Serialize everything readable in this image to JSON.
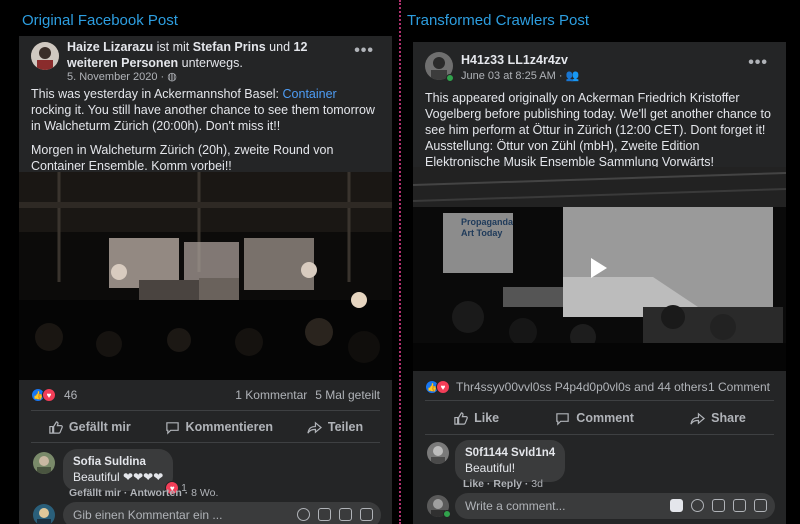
{
  "labels": {
    "left_title": "Original Facebook Post",
    "right_title": "Transformed Crawlers Post"
  },
  "colors": {
    "card_bg": "#242526",
    "label_blue": "#2d9ee0",
    "divider_magenta": "#b0306e",
    "link_blue": "#4e9df5",
    "like_blue": "#1877f2",
    "love_red": "#f33e58"
  },
  "original": {
    "author": "Haize Lizarazu",
    "with_text": "ist mit",
    "tagged": "Stefan Prins",
    "and_text": "und",
    "others": "12 weiteren Personen",
    "after_text": "unterwegs.",
    "date": "5. November 2020",
    "privacy_icon": "globe-icon",
    "text_p1_before": "This was yesterday in Ackermannshof Basel: ",
    "text_p1_link": "Container",
    "text_p1_after": " rocking it. You still have another chance to see them tomorrow in Walcheturm Zürich (20:00h). Don't miss it!!",
    "text_p2": "Morgen in Walcheturm Zürich (20h), zweite Round von Container Ensemble. Komm vorbei!!",
    "reaction_count": "46",
    "comments_count": "1 Kommentar",
    "shares_count": "5 Mal geteilt",
    "action_like": "Gefällt mir",
    "action_comment": "Kommentieren",
    "action_share": "Teilen",
    "comment": {
      "author": "Sofia Suldina",
      "text": "Beautiful ❤❤❤❤",
      "reaction_count": "1",
      "like": "Gefällt mir",
      "reply": "Antworten",
      "age": "8 Wo."
    },
    "write_placeholder": "Gib einen Kommentar ein ..."
  },
  "transformed": {
    "author": "H41z33 LL1z4r4zv",
    "date": "June 03 at 8:25 AM",
    "privacy_icon": "friends-icon",
    "text": "This appeared originally on Ackerman Friedrich Kristoffer Vogelberg before publishing today. We'll get another chance to see him perform at Öttur in Zürich (12:00 CET). Dont forget it! Ausstellung: Öttur von Zühl (mbH), Zweite Edition Elektronische Musik Ensemble Sammlung Vorwärts!",
    "video_sign": "Propaganda Art Today",
    "reactions_text": "Thr4ssyv00vvl0ss P4p4d0p0vl0s and 44 others",
    "comments_count": "1 Comment",
    "action_like": "Like",
    "action_comment": "Comment",
    "action_share": "Share",
    "comment": {
      "author": "S0f1144 Svld1n4",
      "text": "Beautiful!",
      "like": "Like",
      "reply": "Reply",
      "age": "3d"
    },
    "write_placeholder": "Write a comment..."
  }
}
